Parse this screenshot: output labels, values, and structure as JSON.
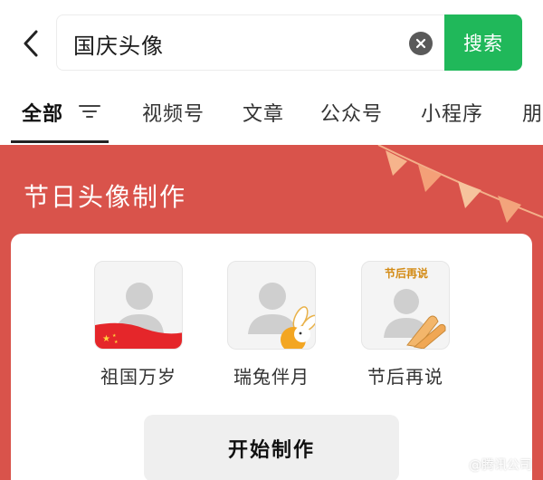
{
  "search": {
    "query": "国庆头像",
    "button_label": "搜索"
  },
  "tabs": [
    {
      "label": "全部",
      "active": true
    },
    {
      "label": "视频号",
      "active": false
    },
    {
      "label": "文章",
      "active": false
    },
    {
      "label": "公众号",
      "active": false
    },
    {
      "label": "小程序",
      "active": false
    },
    {
      "label": "朋",
      "active": false
    }
  ],
  "card": {
    "title": "节日头像制作",
    "start_button": "开始制作",
    "templates": [
      {
        "label": "祖国万岁"
      },
      {
        "label": "瑞兔伴月"
      },
      {
        "label": "节后再说",
        "badge": "节后再说"
      }
    ]
  },
  "watermark": "@腾讯公司",
  "colors": {
    "accent_green": "#20b85a",
    "banner_red": "#d9534b"
  }
}
